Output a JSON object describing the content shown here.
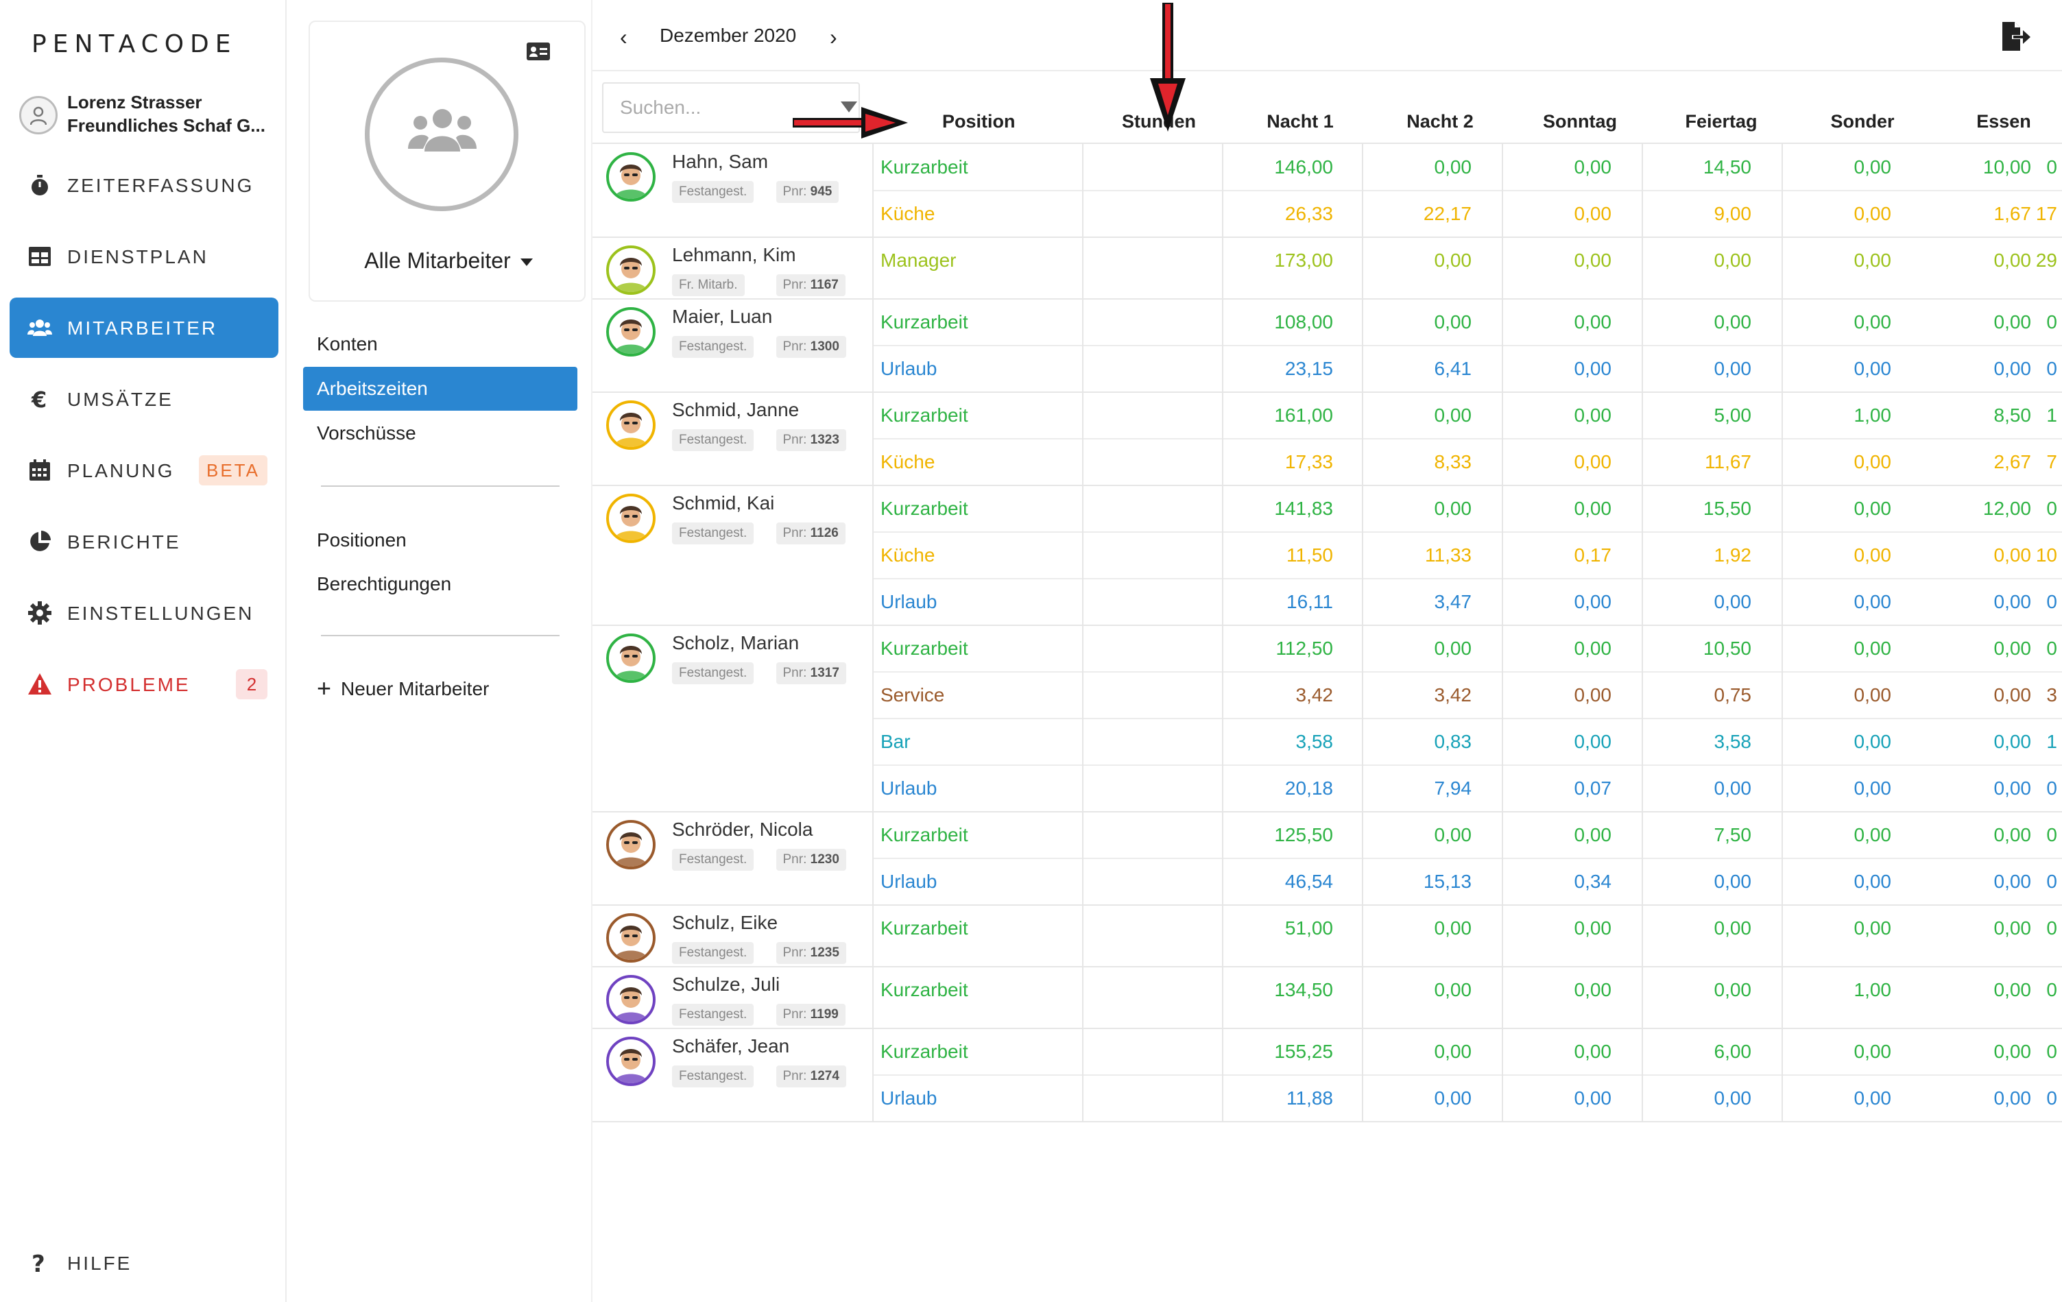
{
  "app": {
    "logo": "PENTACODE"
  },
  "user": {
    "name": "Lorenz Strasser",
    "company": "Freundliches Schaf G..."
  },
  "nav": [
    {
      "label": "ZEITERFASSUNG",
      "icon": "stopwatch-icon"
    },
    {
      "label": "DIENSTPLAN",
      "icon": "table-icon"
    },
    {
      "label": "MITARBEITER",
      "icon": "users-icon",
      "active": true
    },
    {
      "label": "UMSÄTZE",
      "icon": "euro-icon"
    },
    {
      "label": "PLANUNG",
      "icon": "calendar-icon",
      "badge": "BETA"
    },
    {
      "label": "BERICHTE",
      "icon": "pie-chart-icon"
    },
    {
      "label": "EINSTELLUNGEN",
      "icon": "gear-icon"
    },
    {
      "label": "PROBLEME",
      "icon": "warning-icon",
      "badge": "2"
    }
  ],
  "help": {
    "label": "HILFE"
  },
  "group": {
    "title": "Alle Mitarbeiter"
  },
  "subnav": {
    "konten": "Konten",
    "arbeitszeiten": "Arbeitszeiten",
    "vorschuesse": "Vorschüsse",
    "positionen": "Positionen",
    "berechtigungen": "Berechtigungen",
    "neuer_mitarbeiter": "Neuer Mitarbeiter"
  },
  "period": {
    "label": "Dezember 2020"
  },
  "search": {
    "placeholder": "Suchen..."
  },
  "columns": [
    "Position",
    "Stunden",
    "Nacht 1",
    "Nacht 2",
    "Sonntag",
    "Feiertag",
    "Sonder",
    "Essen"
  ],
  "colors": {
    "Kurzarbeit": "#2fb344",
    "Küche": "#f0b400",
    "Manager": "#9cc21c",
    "Urlaub": "#2a86d1",
    "Service": "#9a5a2c",
    "Bar": "#17a2b8",
    "accent": "#2a86d1"
  },
  "employees": [
    {
      "name": "Hahn, Sam",
      "type": "Festangest.",
      "pnr_label": "Pnr:",
      "pnr": "945",
      "ring": "#2fb344",
      "rows": [
        {
          "position": "Kurzarbeit",
          "values": [
            "146,00",
            "0,00",
            "0,00",
            "14,50",
            "0,00",
            "10,00",
            "0"
          ]
        },
        {
          "position": "Küche",
          "values": [
            "26,33",
            "22,17",
            "0,00",
            "9,00",
            "0,00",
            "1,67",
            "17"
          ]
        }
      ]
    },
    {
      "name": "Lehmann, Kim",
      "type": "Fr. Mitarb.",
      "pnr_label": "Pnr:",
      "pnr": "1167",
      "ring": "#9cc21c",
      "rows": [
        {
          "position": "Manager",
          "values": [
            "173,00",
            "0,00",
            "0,00",
            "0,00",
            "0,00",
            "0,00",
            "29"
          ]
        }
      ]
    },
    {
      "name": "Maier, Luan",
      "type": "Festangest.",
      "pnr_label": "Pnr:",
      "pnr": "1300",
      "ring": "#2fb344",
      "rows": [
        {
          "position": "Kurzarbeit",
          "values": [
            "108,00",
            "0,00",
            "0,00",
            "0,00",
            "0,00",
            "0,00",
            "0"
          ]
        },
        {
          "position": "Urlaub",
          "values": [
            "23,15",
            "6,41",
            "0,00",
            "0,00",
            "0,00",
            "0,00",
            "0"
          ]
        }
      ]
    },
    {
      "name": "Schmid, Janne",
      "type": "Festangest.",
      "pnr_label": "Pnr:",
      "pnr": "1323",
      "ring": "#f0b400",
      "rows": [
        {
          "position": "Kurzarbeit",
          "values": [
            "161,00",
            "0,00",
            "0,00",
            "5,00",
            "1,00",
            "8,50",
            "1"
          ]
        },
        {
          "position": "Küche",
          "values": [
            "17,33",
            "8,33",
            "0,00",
            "11,67",
            "0,00",
            "2,67",
            "7"
          ]
        }
      ]
    },
    {
      "name": "Schmid, Kai",
      "type": "Festangest.",
      "pnr_label": "Pnr:",
      "pnr": "1126",
      "ring": "#f0b400",
      "rows": [
        {
          "position": "Kurzarbeit",
          "values": [
            "141,83",
            "0,00",
            "0,00",
            "15,50",
            "0,00",
            "12,00",
            "0"
          ]
        },
        {
          "position": "Küche",
          "values": [
            "11,50",
            "11,33",
            "0,17",
            "1,92",
            "0,00",
            "0,00",
            "10"
          ]
        },
        {
          "position": "Urlaub",
          "values": [
            "16,11",
            "3,47",
            "0,00",
            "0,00",
            "0,00",
            "0,00",
            "0"
          ]
        }
      ]
    },
    {
      "name": "Scholz, Marian",
      "type": "Festangest.",
      "pnr_label": "Pnr:",
      "pnr": "1317",
      "ring": "#2fb344",
      "rows": [
        {
          "position": "Kurzarbeit",
          "values": [
            "112,50",
            "0,00",
            "0,00",
            "10,50",
            "0,00",
            "0,00",
            "0"
          ]
        },
        {
          "position": "Service",
          "values": [
            "3,42",
            "3,42",
            "0,00",
            "0,75",
            "0,00",
            "0,00",
            "3"
          ]
        },
        {
          "position": "Bar",
          "values": [
            "3,58",
            "0,83",
            "0,00",
            "3,58",
            "0,00",
            "0,00",
            "1"
          ]
        },
        {
          "position": "Urlaub",
          "values": [
            "20,18",
            "7,94",
            "0,07",
            "0,00",
            "0,00",
            "0,00",
            "0"
          ]
        }
      ]
    },
    {
      "name": "Schröder, Nicola",
      "type": "Festangest.",
      "pnr_label": "Pnr:",
      "pnr": "1230",
      "ring": "#9a5a2c",
      "rows": [
        {
          "position": "Kurzarbeit",
          "values": [
            "125,50",
            "0,00",
            "0,00",
            "7,50",
            "0,00",
            "0,00",
            "0"
          ]
        },
        {
          "position": "Urlaub",
          "values": [
            "46,54",
            "15,13",
            "0,34",
            "0,00",
            "0,00",
            "0,00",
            "0"
          ]
        }
      ]
    },
    {
      "name": "Schulz, Eike",
      "type": "Festangest.",
      "pnr_label": "Pnr:",
      "pnr": "1235",
      "ring": "#9a5a2c",
      "rows": [
        {
          "position": "Kurzarbeit",
          "values": [
            "51,00",
            "0,00",
            "0,00",
            "0,00",
            "0,00",
            "0,00",
            "0"
          ]
        }
      ]
    },
    {
      "name": "Schulze, Juli",
      "type": "Festangest.",
      "pnr_label": "Pnr:",
      "pnr": "1199",
      "ring": "#6f42c1",
      "rows": [
        {
          "position": "Kurzarbeit",
          "values": [
            "134,50",
            "0,00",
            "0,00",
            "0,00",
            "1,00",
            "0,00",
            "0"
          ]
        }
      ]
    },
    {
      "name": "Schäfer, Jean",
      "type": "Festangest.",
      "pnr_label": "Pnr:",
      "pnr": "1274",
      "ring": "#6f42c1",
      "rows": [
        {
          "position": "Kurzarbeit",
          "values": [
            "155,25",
            "0,00",
            "0,00",
            "6,00",
            "0,00",
            "0,00",
            "0"
          ]
        },
        {
          "position": "Urlaub",
          "values": [
            "11,88",
            "0,00",
            "0,00",
            "0,00",
            "0,00",
            "0,00",
            "0"
          ]
        }
      ]
    }
  ]
}
